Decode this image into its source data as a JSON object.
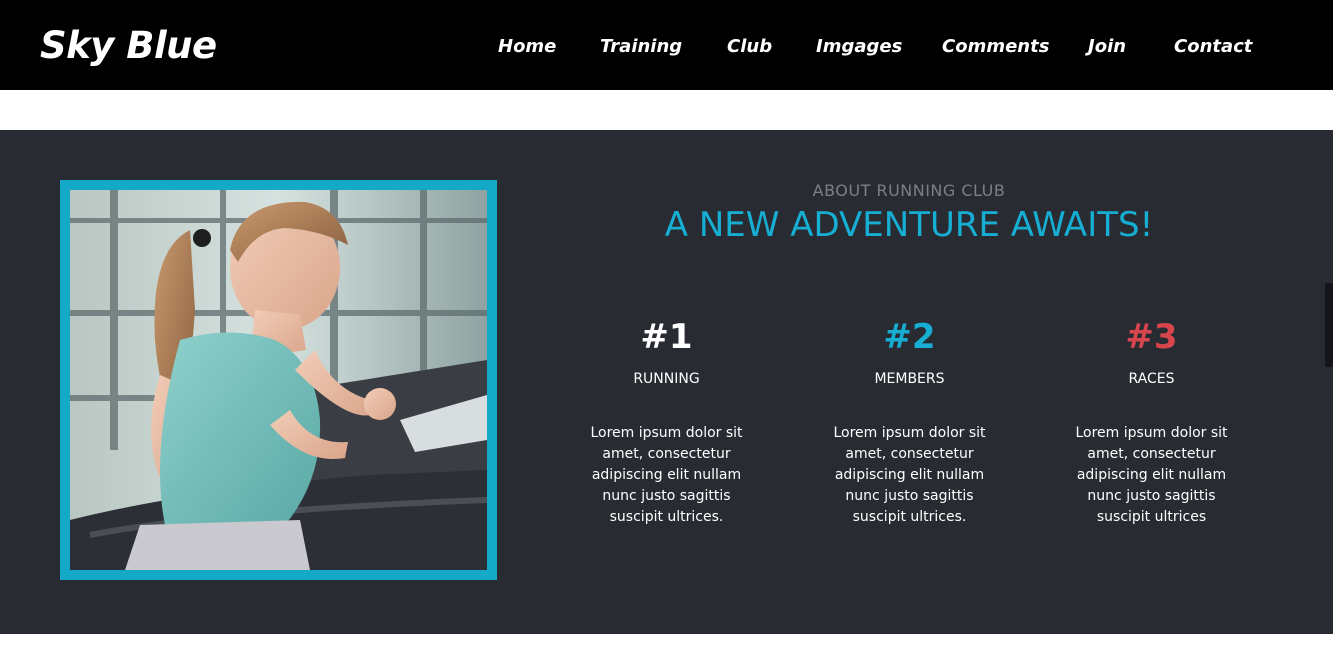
{
  "header": {
    "brand": "Sky Blue",
    "nav": [
      "Home",
      "Training",
      "Club",
      "Imgages",
      "Comments",
      "Join",
      "Contact"
    ]
  },
  "about": {
    "eyebrow": "ABOUT RUNNING CLUB",
    "headline": "A NEW ADVENTURE AWAITS!",
    "features": [
      {
        "number": "#1",
        "label": "RUNNING",
        "text": "Lorem ipsum dolor sit amet, consectetur adipiscing elit nullam nunc justo sagittis suscipit ultrices.",
        "color": "#ffffff"
      },
      {
        "number": "#2",
        "label": "MEMBERS",
        "text": "Lorem ipsum dolor sit amet, consectetur adipiscing elit nullam nunc justo sagittis suscipit ultrices.",
        "color": "#16aed2"
      },
      {
        "number": "#3",
        "label": "RACES",
        "text": "Lorem ipsum dolor sit amet, consectetur adipiscing elit nullam nunc justo sagittis suscipit ultrices",
        "color": "#d9454c"
      }
    ]
  },
  "colors": {
    "header_bg": "#000000",
    "section_bg": "#292b33",
    "accent": "#14a9c6",
    "headline": "#16aed2",
    "eyebrow": "#7d7f86"
  }
}
